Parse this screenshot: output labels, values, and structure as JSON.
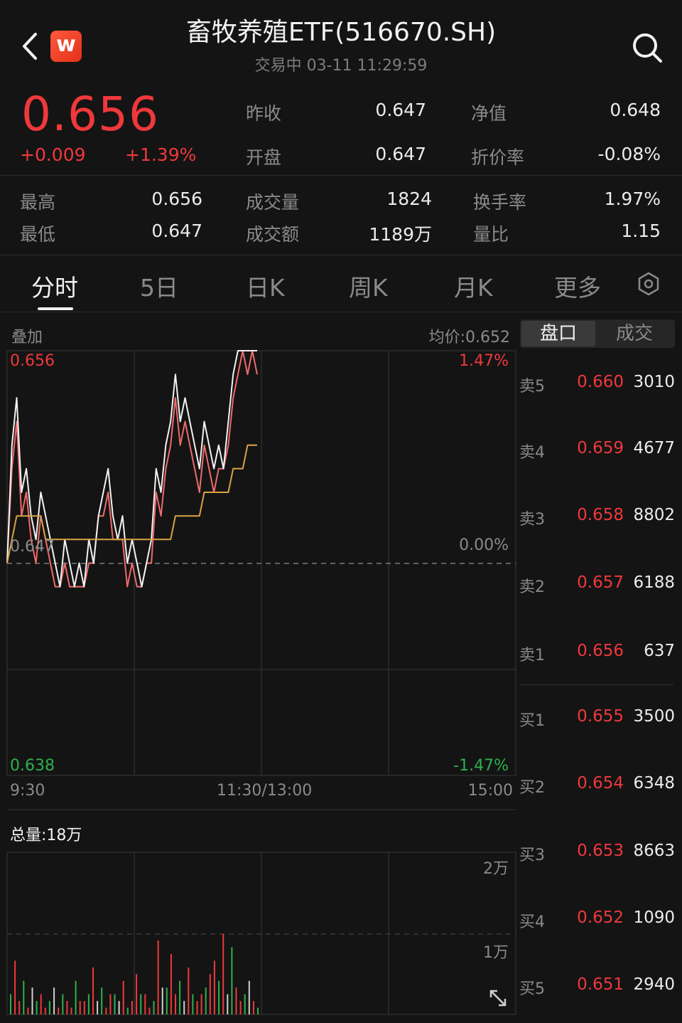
{
  "header": {
    "title": "畜牧养殖ETF(516670.SH)",
    "status": "交易中 03-11 11:29:59",
    "logo_letter": "w"
  },
  "quote": {
    "price": "0.656",
    "change": "+0.009",
    "change_pct": "+1.39%",
    "rows": [
      {
        "l1": "昨收",
        "v1": "0.647",
        "l2": "净值",
        "v2": "0.648"
      },
      {
        "l1": "开盘",
        "v1": "0.647",
        "l2": "折价率",
        "v2": "-0.08%"
      }
    ],
    "stats": [
      {
        "l1": "最高",
        "v1": "0.656",
        "l2": "成交量",
        "v2": "1824",
        "l3": "换手率",
        "v3": "1.97%"
      },
      {
        "l1": "最低",
        "v1": "0.647",
        "l2": "成交额",
        "v2": "1189万",
        "l3": "量比",
        "v3": "1.15"
      }
    ]
  },
  "tabs": [
    "分时",
    "5日",
    "日K",
    "周K",
    "月K",
    "更多"
  ],
  "chart": {
    "overlay_label": "叠加",
    "avg_price_label": "均价:0.652",
    "y_top": "0.656",
    "y_mid": "0.647",
    "y_bottom": "0.638",
    "pct_top": "1.47%",
    "pct_mid": "0.00%",
    "pct_bottom": "-1.47%",
    "x_start": "9:30",
    "x_mid": "11:30/13:00",
    "x_end": "15:00",
    "volume_total": "总量:18万",
    "vol_tick_top": "2万",
    "vol_tick_mid": "1万"
  },
  "chart_data": {
    "type": "line",
    "ylim": [
      0.638,
      0.656
    ],
    "series": [
      {
        "values": [
          0.647,
          0.652,
          0.654,
          0.65,
          0.651,
          0.649,
          0.648,
          0.65,
          0.649,
          0.648,
          0.647,
          0.646,
          0.648,
          0.647,
          0.646,
          0.647,
          0.646,
          0.648,
          0.647,
          0.649,
          0.65,
          0.651,
          0.649,
          0.648,
          0.649,
          0.647,
          0.648,
          0.647,
          0.646,
          0.647,
          0.648,
          0.651,
          0.65,
          0.652,
          0.653,
          0.655,
          0.653,
          0.654,
          0.653,
          0.652,
          0.651,
          0.653,
          0.652,
          0.651,
          0.652,
          0.651,
          0.653,
          0.655,
          0.656,
          0.656,
          0.656,
          0.656,
          0.656
        ]
      },
      {
        "values": [
          0.647,
          0.651,
          0.653,
          0.649,
          0.65,
          0.648,
          0.647,
          0.649,
          0.648,
          0.647,
          0.646,
          0.646,
          0.647,
          0.646,
          0.646,
          0.646,
          0.646,
          0.647,
          0.647,
          0.649,
          0.649,
          0.65,
          0.648,
          0.648,
          0.648,
          0.646,
          0.647,
          0.646,
          0.646,
          0.647,
          0.647,
          0.65,
          0.649,
          0.651,
          0.652,
          0.654,
          0.652,
          0.653,
          0.652,
          0.651,
          0.65,
          0.652,
          0.651,
          0.65,
          0.651,
          0.651,
          0.652,
          0.654,
          0.655,
          0.656,
          0.655,
          0.656,
          0.655
        ]
      },
      {
        "values": [
          0.647,
          0.648,
          0.649,
          0.649,
          0.649,
          0.649,
          0.649,
          0.649,
          0.648,
          0.648,
          0.648,
          0.648,
          0.648,
          0.648,
          0.648,
          0.648,
          0.648,
          0.648,
          0.648,
          0.648,
          0.648,
          0.648,
          0.648,
          0.648,
          0.648,
          0.648,
          0.648,
          0.648,
          0.648,
          0.648,
          0.648,
          0.648,
          0.648,
          0.648,
          0.648,
          0.649,
          0.649,
          0.649,
          0.649,
          0.649,
          0.649,
          0.65,
          0.65,
          0.65,
          0.65,
          0.65,
          0.65,
          0.651,
          0.651,
          0.651,
          0.652,
          0.652,
          0.652
        ]
      }
    ],
    "volume": [
      3,
      8,
      2,
      5,
      1,
      4,
      2,
      3,
      1,
      2,
      4,
      1,
      3,
      2,
      1,
      5,
      2,
      2,
      3,
      7,
      2,
      4,
      1,
      3,
      3,
      2,
      5,
      1,
      2,
      6,
      3,
      3,
      1,
      2,
      11,
      4,
      4,
      9,
      3,
      5,
      2,
      7,
      3,
      2,
      3,
      4,
      6,
      8,
      5,
      12,
      3,
      10,
      4,
      2,
      3,
      5,
      2,
      1
    ]
  },
  "order_book": {
    "toggle": [
      "盘口",
      "成交"
    ],
    "asks": [
      {
        "label": "卖5",
        "price": "0.660",
        "vol": "3010"
      },
      {
        "label": "卖4",
        "price": "0.659",
        "vol": "4677"
      },
      {
        "label": "卖3",
        "price": "0.658",
        "vol": "8802"
      },
      {
        "label": "卖2",
        "price": "0.657",
        "vol": "6188"
      },
      {
        "label": "卖1",
        "price": "0.656",
        "vol": "637"
      }
    ],
    "bids": [
      {
        "label": "买1",
        "price": "0.655",
        "vol": "3500"
      },
      {
        "label": "买2",
        "price": "0.654",
        "vol": "6348"
      },
      {
        "label": "买3",
        "price": "0.653",
        "vol": "8663"
      },
      {
        "label": "买4",
        "price": "0.652",
        "vol": "1090"
      },
      {
        "label": "买5",
        "price": "0.651",
        "vol": "2940"
      }
    ]
  },
  "colors": {
    "up": "#f0383b",
    "down": "#2bb24c",
    "price_line": "#f2f2f2",
    "overlay_line": "#f06b6b",
    "avg_line": "#d9a441"
  }
}
